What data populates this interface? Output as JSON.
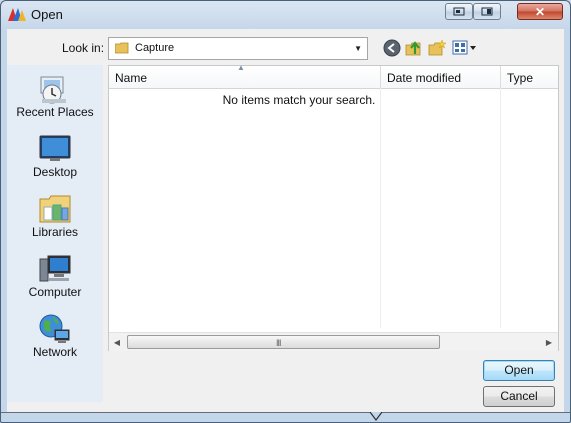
{
  "window": {
    "title": "Open",
    "app_icon": "app-logo-icon",
    "controls": [
      "minimize-icon",
      "restore-icon",
      "close-icon"
    ],
    "close_glyph": "✕"
  },
  "lookin": {
    "label": "Look in:",
    "value": "Capture",
    "icons": [
      "back-icon",
      "up-folder-icon",
      "new-folder-icon",
      "views-menu-icon"
    ]
  },
  "places": [
    {
      "label": "Recent Places",
      "icon": "recent-places-icon"
    },
    {
      "label": "Desktop",
      "icon": "desktop-icon"
    },
    {
      "label": "Libraries",
      "icon": "libraries-icon"
    },
    {
      "label": "Computer",
      "icon": "computer-icon"
    },
    {
      "label": "Network",
      "icon": "network-icon"
    }
  ],
  "filelist": {
    "columns": [
      "Name",
      "Date modified",
      "Type"
    ],
    "empty_message": "No items match your search.",
    "scroll_grip": "III"
  },
  "buttons": {
    "open": "Open",
    "cancel": "Cancel"
  },
  "colors": {
    "titlebar": "#c4d6ea",
    "places_pane": "#e4ecf6",
    "close_button": "#c2452f",
    "default_button_border": "#3c7fb1"
  }
}
